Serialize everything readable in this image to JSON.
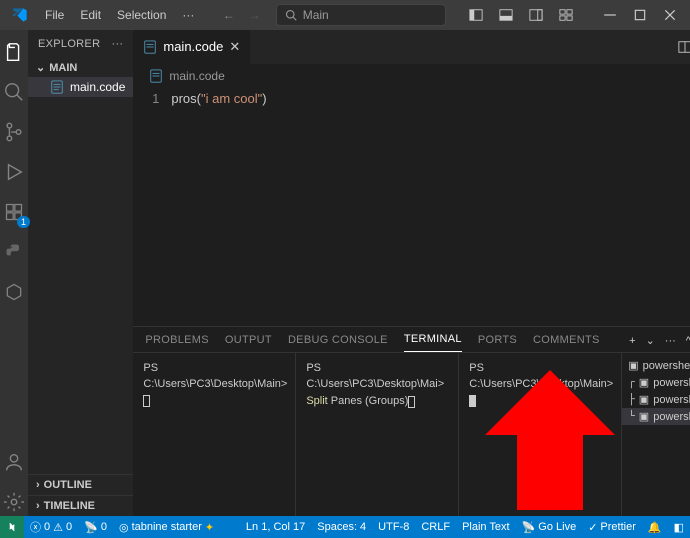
{
  "menu": {
    "file": "File",
    "edit": "Edit",
    "selection": "Selection",
    "more": "···"
  },
  "search_placeholder": "Main",
  "explorer": {
    "title": "EXPLORER",
    "folder": "MAIN",
    "file": "main.code",
    "outline": "OUTLINE",
    "timeline": "TIMELINE"
  },
  "tab": {
    "filename": "main.code"
  },
  "breadcrumb": {
    "file": "main.code"
  },
  "editor": {
    "line_num": "1",
    "code_prefix": "pros(",
    "code_str": "\"i am cool\"",
    "code_suffix": ")"
  },
  "panel": {
    "tabs": {
      "problems": "PROBLEMS",
      "output": "OUTPUT",
      "debug": "DEBUG CONSOLE",
      "terminal": "TERMINAL",
      "ports": "PORTS",
      "comments": "COMMENTS"
    }
  },
  "terminals": {
    "t1": "PS C:\\Users\\PC3\\Desktop\\Main> ",
    "t2a": "PS C:\\Users\\PC3\\Desktop\\Mai> ",
    "t2b": "Split",
    "t2c": " Panes (Groups)",
    "t3": "PS C:\\Users\\PC3\\Desktop\\Main> ",
    "list": [
      "powershell",
      "powershell",
      "powershell",
      "powershell"
    ]
  },
  "status": {
    "errors": "0",
    "warnings": "0",
    "ports": "0",
    "tabnine": "tabnine starter",
    "ln": "Ln 1, Col 17",
    "spaces": "Spaces: 4",
    "encoding": "UTF-8",
    "eol": "CRLF",
    "lang": "Plain Text",
    "golive": "Go Live",
    "prettier": "Prettier"
  }
}
